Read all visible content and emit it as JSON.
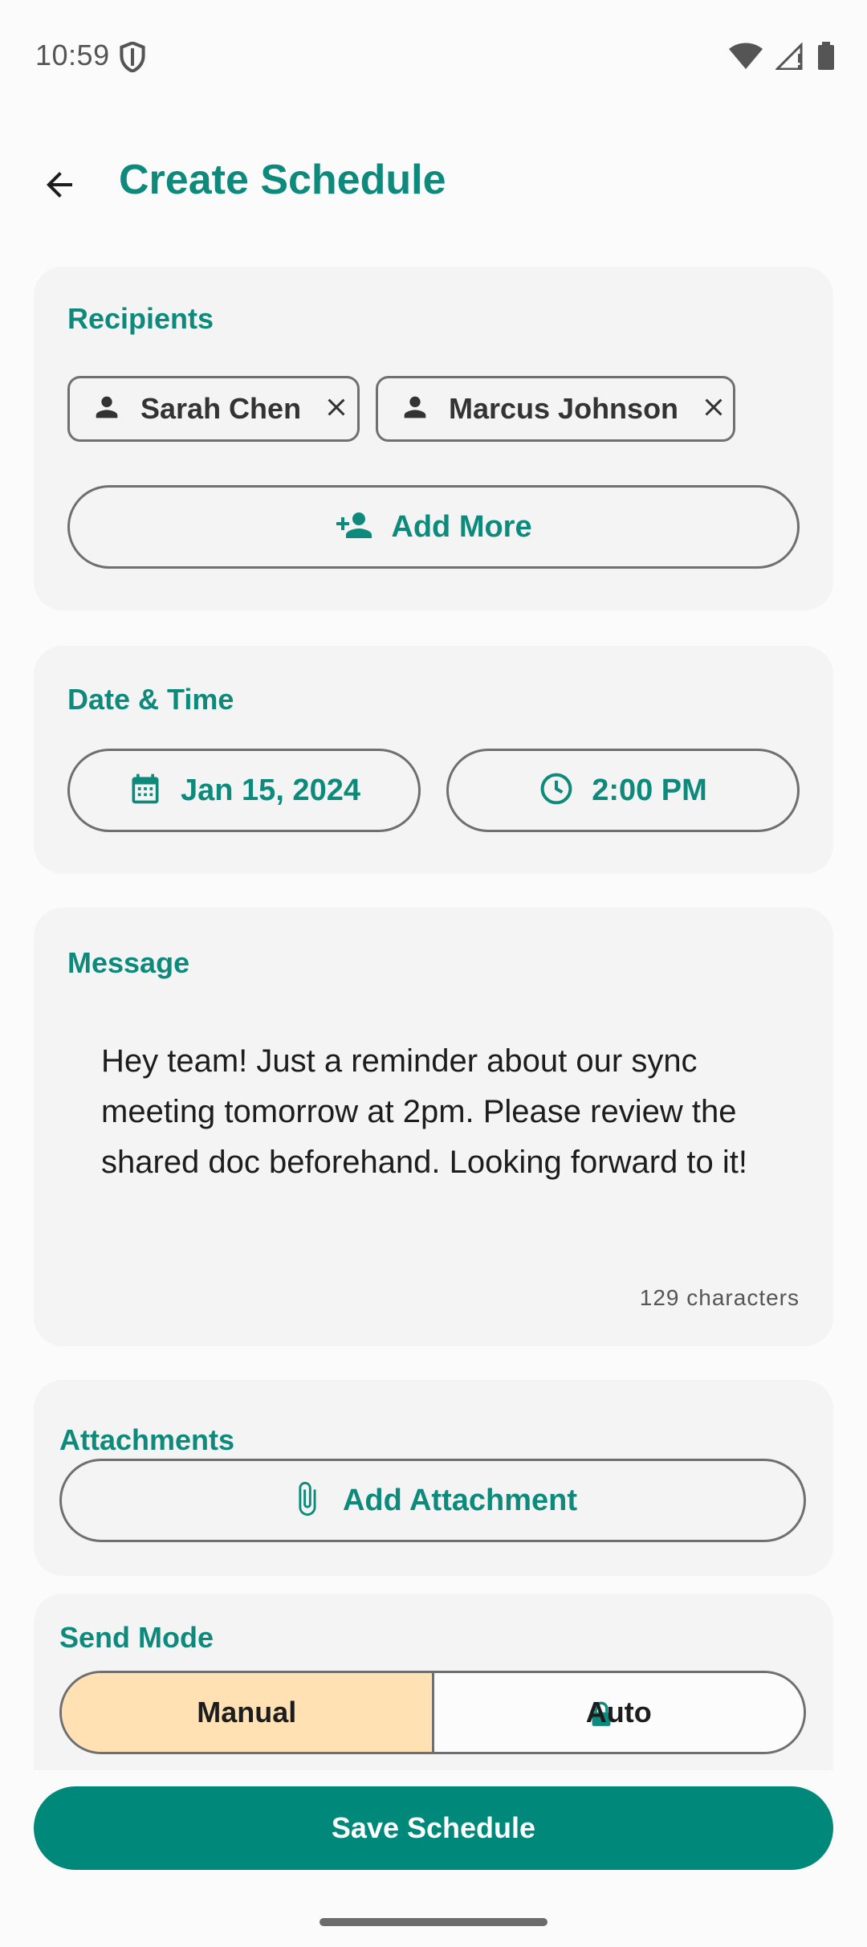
{
  "status_bar": {
    "time": "10:59"
  },
  "header": {
    "title": "Create Schedule"
  },
  "recipients": {
    "label": "Recipients",
    "chips": [
      {
        "name": "Sarah Chen"
      },
      {
        "name": "Marcus Johnson"
      }
    ],
    "add_more_label": "Add More"
  },
  "datetime": {
    "label": "Date & Time",
    "date": "Jan 15, 2024",
    "time": "2:00 PM"
  },
  "message": {
    "label": "Message",
    "text": "Hey team! Just a reminder about our sync meeting tomorrow at 2pm. Please review the shared doc beforehand. Looking forward to it!",
    "char_count": "129 characters"
  },
  "attachments": {
    "label": "Attachments",
    "add_label": "Add Attachment"
  },
  "send_mode": {
    "label": "Send Mode",
    "options": [
      "Manual",
      "Auto"
    ],
    "selected": "Manual"
  },
  "footer": {
    "save_label": "Save Schedule"
  },
  "colors": {
    "accent": "#0d8a7b",
    "primary_button": "#00897b",
    "selected_segment": "#ffe1b3",
    "card_bg": "#f4f4f4"
  }
}
